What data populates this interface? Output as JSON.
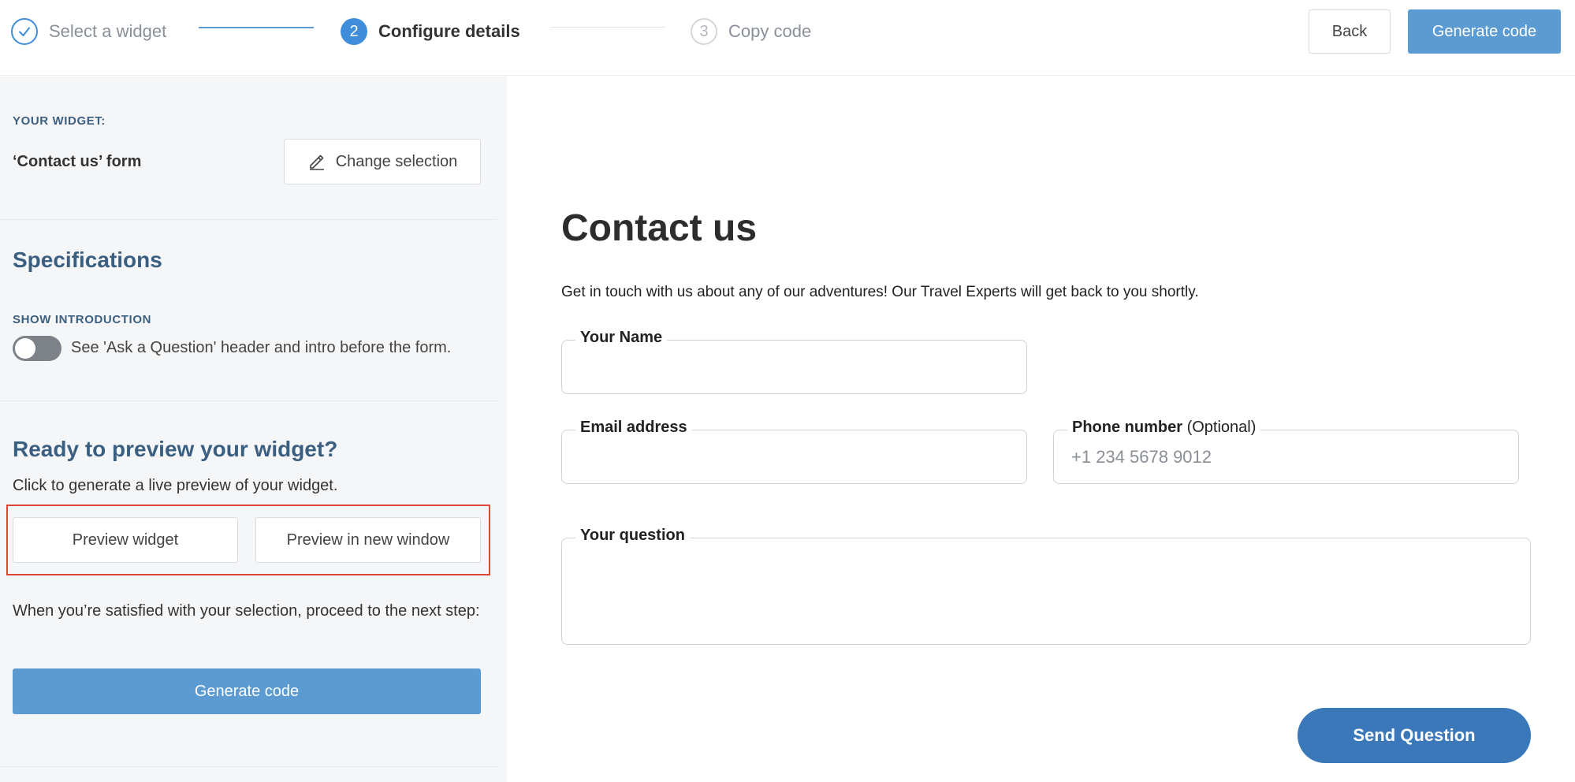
{
  "stepper": {
    "step1": {
      "label": "Select a widget"
    },
    "step2": {
      "number": "2",
      "label": "Configure details"
    },
    "step3": {
      "number": "3",
      "label": "Copy code"
    }
  },
  "header": {
    "back_label": "Back",
    "generate_label": "Generate code"
  },
  "sidebar": {
    "your_widget_label": "YOUR WIDGET:",
    "widget_name": "‘Contact us’ form",
    "change_label": "Change selection",
    "spec_title": "Specifications",
    "show_intro_label": "SHOW INTRODUCTION",
    "show_intro_desc": "See 'Ask a Question' header and intro before the form.",
    "show_intro_enabled": false,
    "ready_title": "Ready to preview your widget?",
    "ready_desc": "Click to generate a live preview of your widget.",
    "preview_label": "Preview widget",
    "preview_new_label": "Preview in new window",
    "proceed_text": "When you’re satisfied with your selection, proceed to the next step:",
    "generate_label": "Generate code"
  },
  "form": {
    "title": "Contact us",
    "intro": "Get in touch with us about any of our adventures! Our Travel Experts will get back to you shortly.",
    "name_label": "Your Name",
    "name_value": "",
    "email_label": "Email address",
    "email_value": "",
    "phone_label": "Phone number",
    "phone_optional": "(Optional)",
    "phone_placeholder": "+1 234 5678 9012",
    "question_label": "Your question",
    "question_value": "",
    "submit_label": "Send Question"
  },
  "colors": {
    "accent": "#3f8ddb",
    "button_primary": "#5b9bd1",
    "send_button": "#3a78b9",
    "heading": "#3a5f80",
    "highlight": "#e0463a"
  }
}
